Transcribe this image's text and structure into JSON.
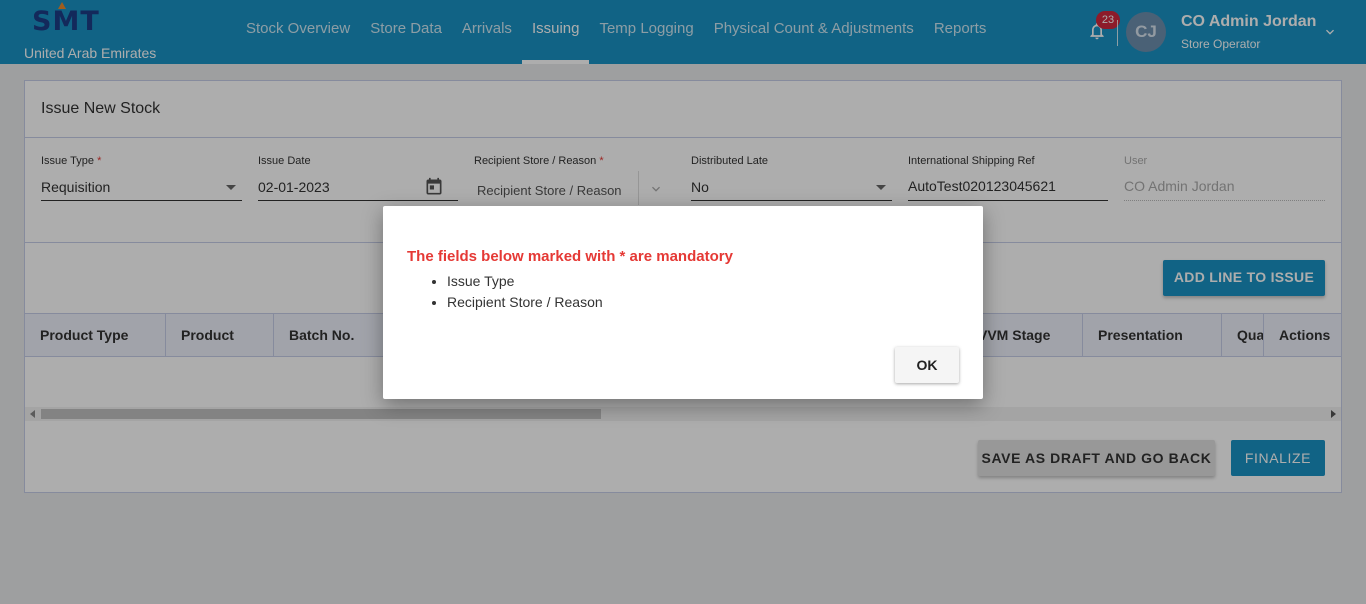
{
  "header": {
    "logo": "SMT",
    "country": "United Arab Emirates",
    "nav": [
      "Stock Overview",
      "Store Data",
      "Arrivals",
      "Issuing",
      "Temp Logging",
      "Physical Count & Adjustments",
      "Reports"
    ],
    "active_nav": "Issuing",
    "notification_count": "23",
    "avatar_initials": "CJ",
    "user_name": "CO Admin Jordan",
    "user_role": "Store Operator"
  },
  "form": {
    "title": "Issue New Stock",
    "issue_type": {
      "label": "Issue Type",
      "required_mark": "*",
      "value": "Requisition"
    },
    "issue_date": {
      "label": "Issue Date",
      "value": "02-01-2023"
    },
    "recipient": {
      "label": "Recipient Store / Reason",
      "required_mark": "*",
      "placeholder": "Recipient Store / Reason"
    },
    "distributed_late": {
      "label": "Distributed Late",
      "value": "No"
    },
    "shipping_ref": {
      "label": "International Shipping Ref",
      "value": "AutoTest020123045621"
    },
    "user": {
      "label": "User",
      "value": "CO Admin Jordan"
    }
  },
  "actions": {
    "add_line": "ADD LINE TO ISSUE",
    "save_draft": "SAVE AS DRAFT AND GO BACK",
    "finalize": "FINALIZE"
  },
  "table": {
    "columns": [
      "Product Type",
      "Product",
      "Batch No.",
      "VVM Stage",
      "Presentation",
      "Qua",
      "Actions"
    ]
  },
  "dialog": {
    "message": "The fields below marked with * are mandatory",
    "items": [
      "Issue Type",
      "Recipient Store / Reason"
    ],
    "ok": "OK"
  },
  "colors": {
    "primary": "#1a93c4",
    "brand_text": "#1c3d86",
    "error": "#e53935",
    "badge": "#d0283f"
  }
}
